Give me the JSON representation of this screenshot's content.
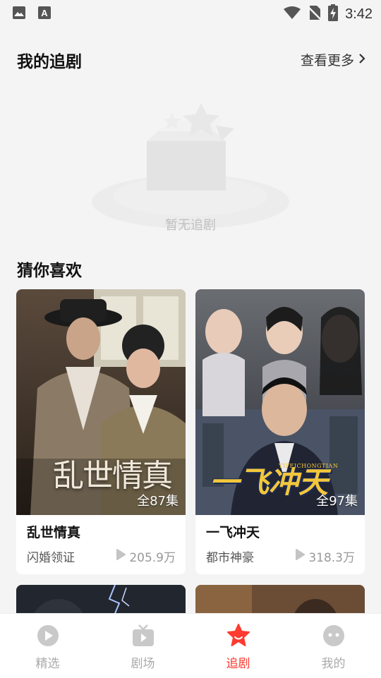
{
  "status_bar": {
    "time": "3:42",
    "icons": [
      "image-icon",
      "text-a-icon",
      "wifi-icon",
      "no-sim-icon",
      "battery-charging-icon"
    ]
  },
  "my_shows": {
    "title": "我的追剧",
    "more_label": "查看更多",
    "empty_text": "暂无追剧"
  },
  "recommend": {
    "title": "猜你喜欢",
    "items": [
      {
        "title": "乱世情真",
        "poster_text": "乱世情真",
        "episodes": "全87集",
        "tag": "闪婚领证",
        "views": "205.9万"
      },
      {
        "title": "一飞冲天",
        "poster_text": "一飞冲天",
        "poster_subtext": "YIFEICHONGTIAN",
        "episodes": "全97集",
        "tag": "都市神豪",
        "views": "318.3万"
      }
    ]
  },
  "bottom_nav": {
    "items": [
      {
        "label": "精选",
        "icon": "play-circle-icon"
      },
      {
        "label": "剧场",
        "icon": "tv-icon"
      },
      {
        "label": "追剧",
        "icon": "star-face-icon"
      },
      {
        "label": "我的",
        "icon": "face-icon"
      }
    ],
    "active_index": 2,
    "active_color": "#ff3b2f"
  }
}
